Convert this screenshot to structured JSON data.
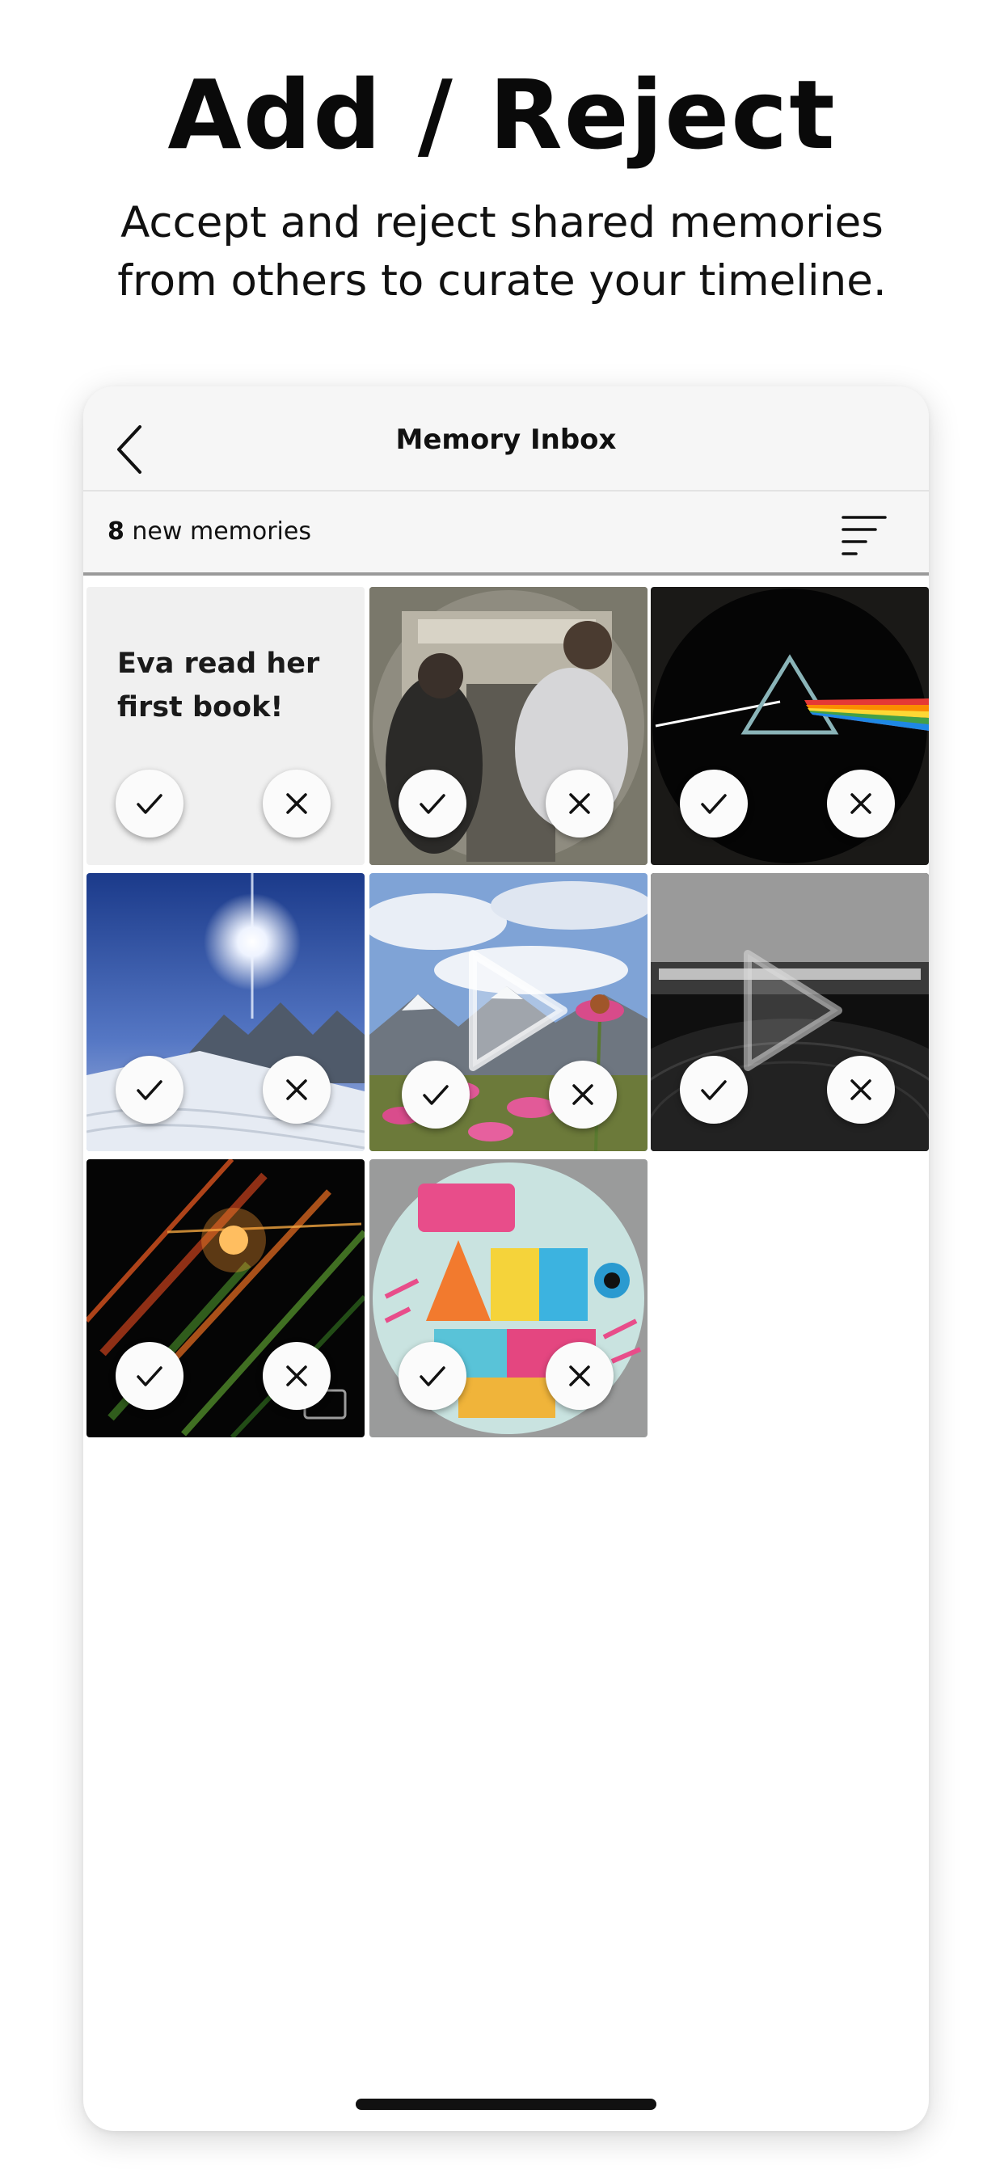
{
  "headline": "Add / Reject",
  "subheadline_line1": "Accept and reject shared memories",
  "subheadline_line2": "from others to curate your timeline.",
  "nav": {
    "title": "Memory Inbox",
    "back_icon": "chevron-left-icon",
    "filter_icon": "sort-filter-icon"
  },
  "summary": {
    "count": "8",
    "label": "new memories"
  },
  "memories": [
    {
      "type": "text",
      "text": "Eva read her first book!"
    },
    {
      "type": "photo",
      "subject": "people-in-record-store"
    },
    {
      "type": "photo",
      "subject": "prism-rainbow-album"
    },
    {
      "type": "photo",
      "subject": "snowy-mountain-sun"
    },
    {
      "type": "video",
      "subject": "flowers-mountains"
    },
    {
      "type": "video",
      "subject": "turntable"
    },
    {
      "type": "photo",
      "subject": "light-streaks"
    },
    {
      "type": "photo",
      "subject": "colorful-record-label"
    }
  ],
  "actions": {
    "accept_icon": "check-icon",
    "reject_icon": "close-icon"
  },
  "colors": {
    "background": "#ffffff",
    "bar": "#f6f6f6",
    "text": "#111111",
    "button": "#fbfbfb"
  }
}
